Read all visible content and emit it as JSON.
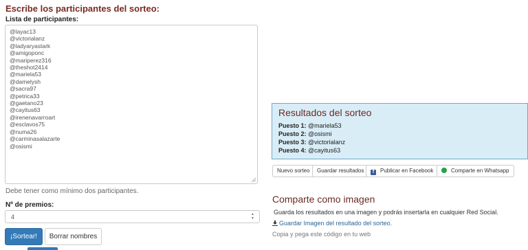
{
  "heading": "Escribe los participantes del sorteo:",
  "participants_label": "Lista de participantes:",
  "participants": [
    "@layac13",
    "@victorialanz",
    "@ladyaryastark",
    "@amigoponc",
    "@mariperez316",
    "@theshot2414",
    "@mariela53",
    "@damelysh",
    "@sacra97",
    "@petrica33",
    "@gaetano23",
    "@cayitus63",
    "@irenenavarroart",
    "@esclavos75",
    "@numa26",
    "@carminasalazarte",
    "@osismi"
  ],
  "help_text": "Debe tener como mínimo dos participantes.",
  "prizes_label": "Nº de premios:",
  "prizes_value": "4",
  "buttons": {
    "draw": "¡Sortear!",
    "clear": "Borrar nombres"
  },
  "results": {
    "title": "Resultados del sorteo",
    "places": [
      {
        "label": "Puesto 1:",
        "name": "@mariela53"
      },
      {
        "label": "Puesto 2:",
        "name": "@osismi"
      },
      {
        "label": "Puesto 3:",
        "name": "@victorialanz"
      },
      {
        "label": "Puesto 4:",
        "name": "@cayitus63"
      }
    ]
  },
  "actions": {
    "new": "Nuevo sorteo",
    "save": "Guardar resultados",
    "facebook": "Publicar en Facebook",
    "whatsapp": "Comparte en Whatsapp"
  },
  "share": {
    "title": "Comparte como imagen",
    "desc": "Guarda los resultados en una imagen y podrás insertarla en cualquier Red Social.",
    "download": "Guardar Imagen del resultado del sorteo.",
    "copy": "Copia y pega este código en tu web"
  },
  "colors": {
    "accent": "#7a2a22",
    "primary": "#337ab7",
    "results_bg": "#d9edf7",
    "link": "#2a6496"
  },
  "icons": {
    "facebook": "facebook-icon",
    "whatsapp": "whatsapp-icon",
    "download": "download-icon"
  }
}
